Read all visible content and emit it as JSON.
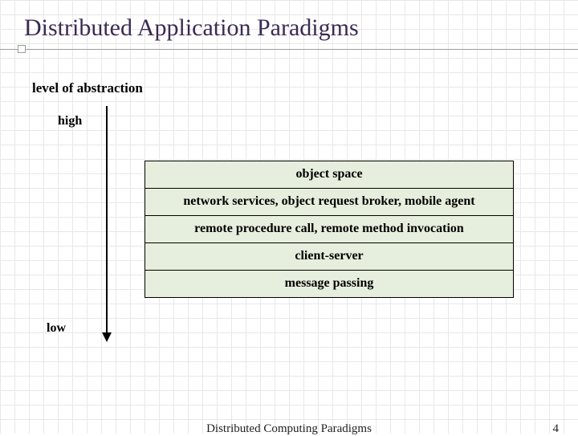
{
  "slide": {
    "title": "Distributed Application Paradigms",
    "axis_label": "level of abstraction",
    "high_label": "high",
    "low_label": "low",
    "layers": [
      "object space",
      "network services, object request broker, mobile agent",
      "remote procedure call, remote method invocation",
      "client-server",
      "message passing"
    ],
    "footer_title": "Distributed Computing Paradigms",
    "page_number": "4"
  }
}
